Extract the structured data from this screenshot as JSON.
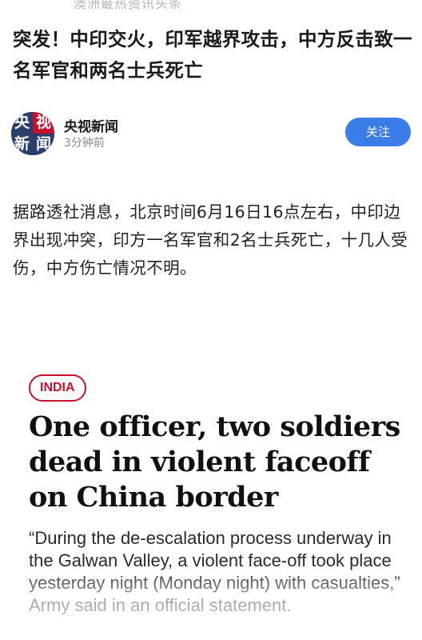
{
  "top_banner": {
    "text": "澳洲最热资讯头条"
  },
  "article": {
    "headline": "突发！中印交火，印军越界攻击，中方反击致一名军官和两名士兵死亡"
  },
  "author": {
    "name": "央视新闻",
    "time": "3分钟前",
    "follow_label": "关注",
    "avatar_chars": [
      "央",
      "视",
      "新",
      "闻"
    ]
  },
  "body": {
    "paragraph": "据路透社消息，北京时间6月16日16点左右，中印边界出现冲突，印方一名军官和2名士兵死亡，十几人受伤，中方伤亡情况不明。"
  },
  "embed": {
    "tag": "INDIA",
    "title": "One officer, two soldiers dead in violent faceoff on China border",
    "quote": "“During the de-escalation process underway in the Galwan Valley, a violent face-off took place yesterday night (Monday night) with casualties,” Army said in an official statement."
  },
  "colors": {
    "follow_button": "#3a7ce8",
    "tag_red": "#c8102e",
    "avatar_blue": "#2a3f6b"
  }
}
